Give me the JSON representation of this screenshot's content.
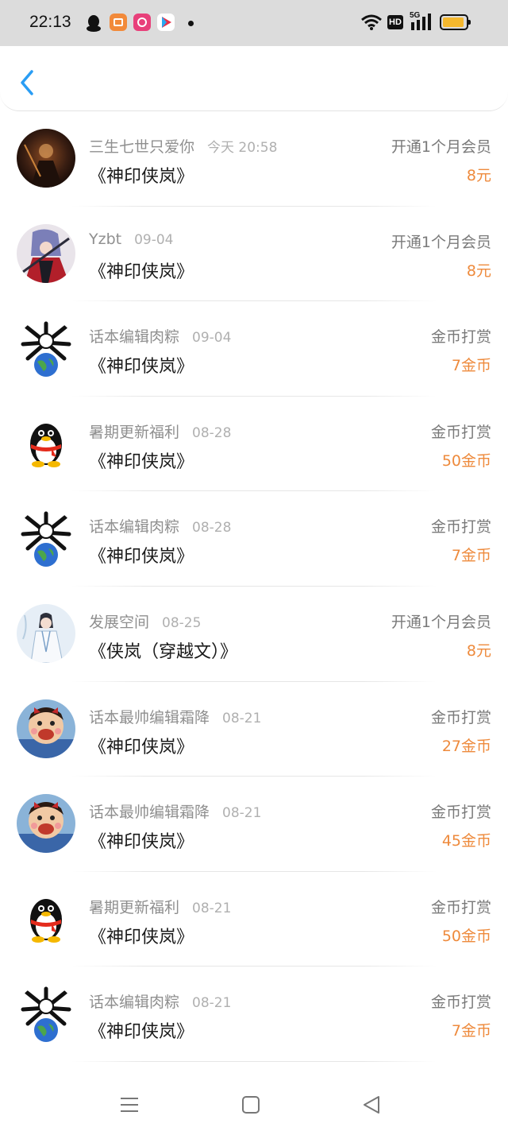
{
  "status_bar": {
    "time": "22:13",
    "network": "5G",
    "hd_label": "HD",
    "icons": [
      "qq-icon",
      "orange-app-icon",
      "pink-app-icon",
      "play-app-icon",
      "dot-icon",
      "wifi-icon",
      "hd-icon",
      "signal-icon",
      "battery-icon"
    ]
  },
  "header": {
    "back_icon": "chevron-left-icon"
  },
  "records": [
    {
      "name": "三生七世只爱你",
      "date": "今天 20:58",
      "book": "《神印侠岚》",
      "type": "开通1个月会员",
      "amount": "8元",
      "avatar": "dark-warrior"
    },
    {
      "name": "Yzbt",
      "date": "09-04",
      "book": "《神印侠岚》",
      "type": "开通1个月会员",
      "amount": "8元",
      "avatar": "red-swordsman"
    },
    {
      "name": "话本编辑肉粽",
      "date": "09-04",
      "book": "《神印侠岚》",
      "type": "金币打赏",
      "amount": "7金币",
      "avatar": "globe-bones"
    },
    {
      "name": "暑期更新福利",
      "date": "08-28",
      "book": "《神印侠岚》",
      "type": "金币打赏",
      "amount": "50金币",
      "avatar": "penguin"
    },
    {
      "name": "话本编辑肉粽",
      "date": "08-28",
      "book": "《神印侠岚》",
      "type": "金币打赏",
      "amount": "7金币",
      "avatar": "globe-bones"
    },
    {
      "name": "发展空间",
      "date": "08-25",
      "book": "《侠岚（穿越文）》",
      "type": "开通1个月会员",
      "amount": "8元",
      "avatar": "white-robed-figure"
    },
    {
      "name": "话本最帅编辑霜降",
      "date": "08-21",
      "book": "《神印侠岚》",
      "type": "金币打赏",
      "amount": "27金币",
      "avatar": "cartoon-boy"
    },
    {
      "name": "话本最帅编辑霜降",
      "date": "08-21",
      "book": "《神印侠岚》",
      "type": "金币打赏",
      "amount": "45金币",
      "avatar": "cartoon-boy"
    },
    {
      "name": "暑期更新福利",
      "date": "08-21",
      "book": "《神印侠岚》",
      "type": "金币打赏",
      "amount": "50金币",
      "avatar": "penguin"
    },
    {
      "name": "话本编辑肉粽",
      "date": "08-21",
      "book": "《神印侠岚》",
      "type": "金币打赏",
      "amount": "7金币",
      "avatar": "globe-bones"
    }
  ],
  "nav_bar": {
    "icons": [
      "menu-icon",
      "home-square-icon",
      "back-triangle-icon"
    ]
  },
  "colors": {
    "amount": "#ee8a3c",
    "back_icon": "#2a9df4",
    "status_bar_bg": "#dcdcdc"
  }
}
